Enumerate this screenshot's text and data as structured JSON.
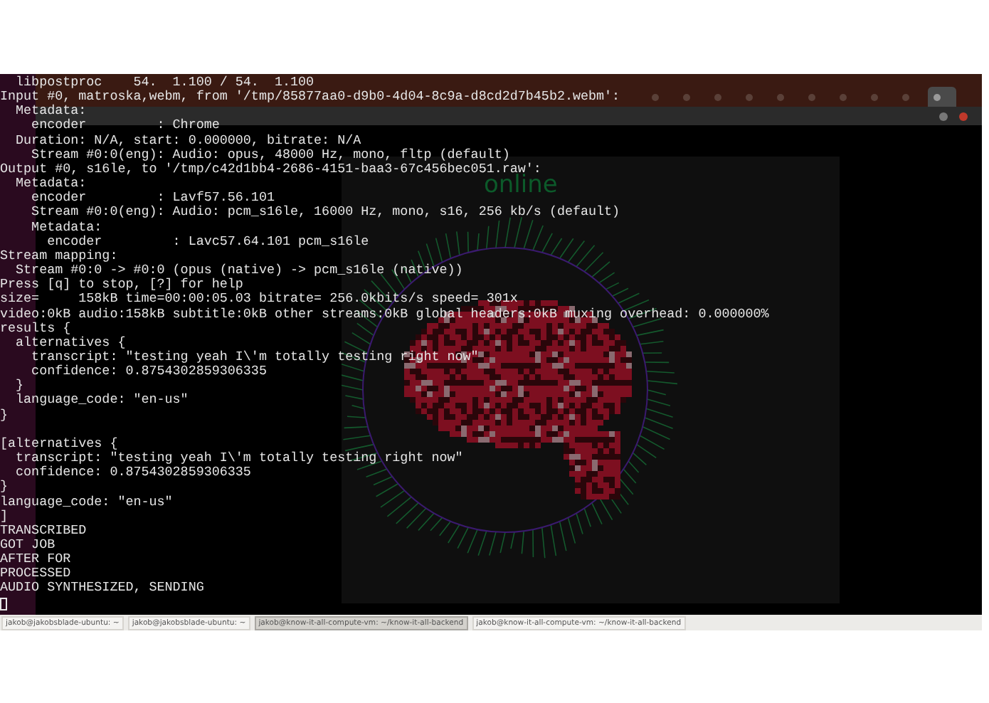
{
  "terminal": {
    "blocks": [
      [
        "  libpostproc    54.  1.100 / 54.  1.100",
        "Input #0, matroska,webm, from '/tmp/85877aa0-d9b0-4d04-8c9a-d8cd2d7b45b2.webm':",
        "  Metadata:",
        "    encoder         : Chrome",
        "  Duration: N/A, start: 0.000000, bitrate: N/A",
        "    Stream #0:0(eng): Audio: opus, 48000 Hz, mono, fltp (default)",
        "Output #0, s16le, to '/tmp/c42d1bb4-2686-4151-baa3-67c456bec051.raw':",
        "  Metadata:",
        "    encoder         : Lavf57.56.101",
        "    Stream #0:0(eng): Audio: pcm_s16le, 16000 Hz, mono, s16, 256 kb/s (default)",
        "    Metadata:",
        "      encoder         : Lavc57.64.101 pcm_s16le",
        "Stream mapping:",
        "  Stream #0:0 -> #0:0 (opus (native) -> pcm_s16le (native))",
        "Press [q] to stop, [?] for help",
        "size=     158kB time=00:00:05.03 bitrate= 256.0kbits/s speed= 301x",
        "video:0kB audio:158kB subtitle:0kB other streams:0kB global headers:0kB muxing overhead: 0.000000%",
        "results {",
        "  alternatives {",
        "    transcript: \"testing yeah I\\'m totally testing right now\"",
        "    confidence: 0.8754302859306335",
        "  }",
        "  language_code: \"en-us\"",
        "}"
      ],
      [
        "[alternatives {",
        "  transcript: \"testing yeah I\\'m totally testing right now\"",
        "  confidence: 0.8754302859306335",
        "}",
        "language_code: \"en-us\"",
        "]",
        "TRANSCRIBED",
        "GOT JOB",
        "AFTER FOR",
        "PROCESSED",
        "AUDIO SYNTHESIZED, SENDING"
      ]
    ]
  },
  "browser": {
    "tabs": [
      {
        "selected": false
      },
      {
        "selected": false
      },
      {
        "selected": false
      },
      {
        "selected": false
      },
      {
        "selected": false
      },
      {
        "selected": false
      },
      {
        "selected": false
      },
      {
        "selected": false
      },
      {
        "selected": false
      },
      {
        "selected": true
      }
    ],
    "panel": {
      "status": "online"
    }
  },
  "taskbar": {
    "buttons": [
      {
        "label": "jakob@jakobsblade-ubuntu: ~",
        "selected": false
      },
      {
        "label": "jakob@jakobsblade-ubuntu: ~",
        "selected": false
      },
      {
        "label": "jakob@know-it-all-compute-vm: ~/know-it-all-backend",
        "selected": true
      },
      {
        "label": "jakob@know-it-all-compute-vm: ~/know-it-all-backend",
        "selected": false
      }
    ]
  }
}
